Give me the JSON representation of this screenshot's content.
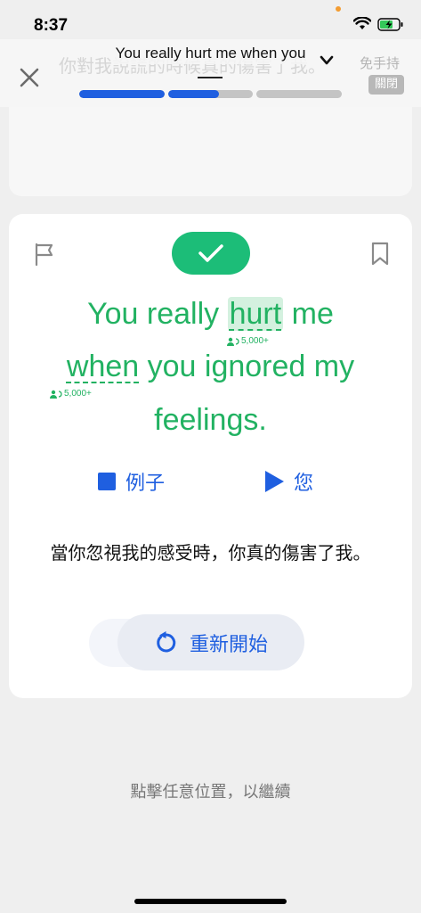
{
  "status_bar": {
    "time": "8:37"
  },
  "header": {
    "title": "You really hurt me when you",
    "faded_subtitle": "你對我說謊的時候真的傷害了我。",
    "handsfree_label": "免手持",
    "handsfree_state": "關閉",
    "progress": [
      {
        "fraction": 1.0
      },
      {
        "fraction": 0.6
      },
      {
        "fraction": 0.0
      }
    ]
  },
  "card": {
    "sentence": {
      "line1_before": "You really ",
      "line1_word": "hurt",
      "line1_after": " me",
      "line2_word": "when",
      "line2_after": " you ignored my",
      "line3": "feelings."
    },
    "word_freq": {
      "hurt": "5,000+",
      "when": "5,000+"
    },
    "controls": {
      "example_label": "例子",
      "you_label": "您"
    },
    "translation": "當你忽視我的感受時，你真的傷害了我。",
    "restart_label": "重新開始"
  },
  "footer": {
    "tap_hint": "點擊任意位置，以繼續"
  },
  "colors": {
    "accent": "#1f5fe0",
    "green": "#22b262",
    "check": "#1cbd78"
  }
}
